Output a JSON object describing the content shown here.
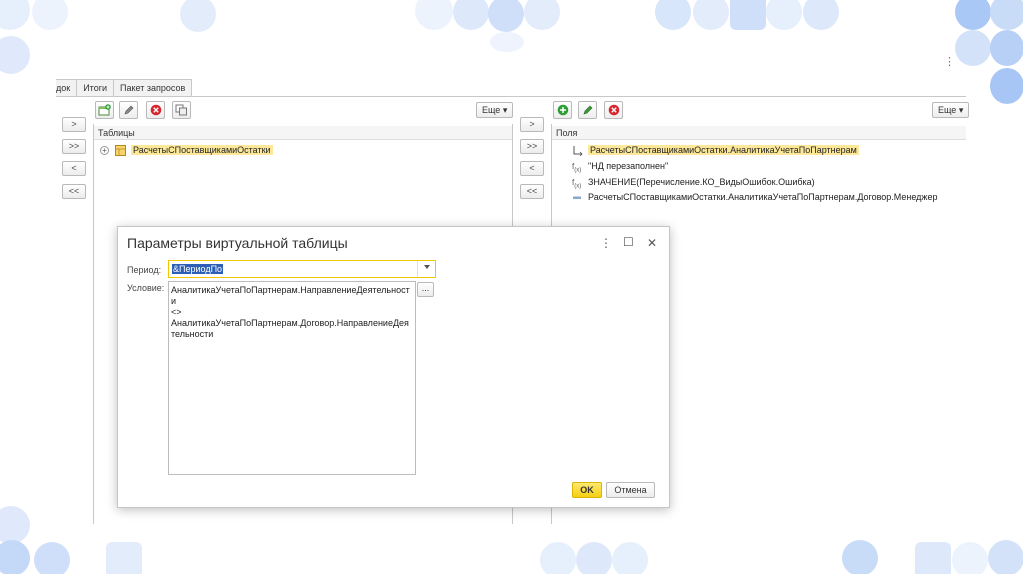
{
  "tabs": [
    "док",
    "Итоги",
    "Пакет запросов"
  ],
  "left_pane": {
    "header": "Таблицы",
    "more_label": "Еще ▾",
    "tables": [
      "РасчетыСПоставщикамиОстатки"
    ]
  },
  "arrow_buttons": [
    ">",
    ">>",
    "<",
    "<<"
  ],
  "right_pane": {
    "header": "Поля",
    "more_label": "Еще ▾",
    "fields": [
      "РасчетыСПоставщикамиОстатки.АналитикаУчетаПоПартнерам",
      "\"НД перезаполнен\"",
      "ЗНАЧЕНИЕ(Перечисление.КО_ВидыОшибок.Ошибка)",
      "РасчетыСПоставщикамиОстатки.АналитикаУчетаПоПартнерам.Договор.Менеджер"
    ]
  },
  "dialog": {
    "title": "Параметры виртуальной таблицы",
    "period_label": "Период:",
    "period_value": "&ПериодПо",
    "condition_label": "Условие:",
    "condition_value": "АналитикаУчетаПоПартнерам.НаправлениеДеятельности\n<>\nАналитикаУчетаПоПартнерам.Договор.НаправлениеДеятельности",
    "dots_label": "...",
    "ok_label": "OK",
    "cancel_label": "Отмена",
    "menu_glyph": "⋮",
    "maximize_glyph": "☐",
    "close_glyph": "✕"
  },
  "top_menu_glyph": "⋮",
  "colors": {
    "highlight": "#fde899",
    "selection": "#2c5fb5",
    "ok_button": "#f5cf10",
    "deco_blue": "#d7e6fb"
  }
}
